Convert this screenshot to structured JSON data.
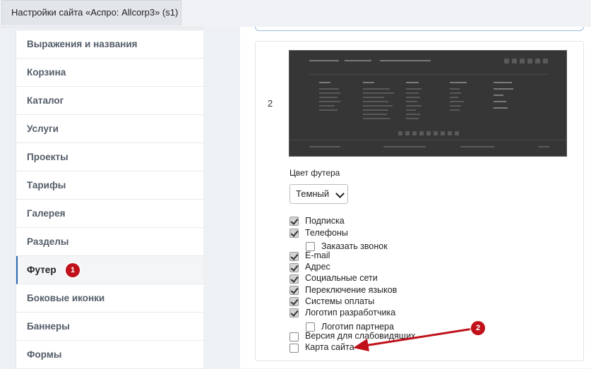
{
  "window": {
    "tab_title": "Настройки сайта «Аспро: Allcorp3» (s1)"
  },
  "sidebar": {
    "items": [
      {
        "label": "Выражения и названия",
        "active": false
      },
      {
        "label": "Корзина",
        "active": false
      },
      {
        "label": "Каталог",
        "active": false
      },
      {
        "label": "Услуги",
        "active": false
      },
      {
        "label": "Проекты",
        "active": false
      },
      {
        "label": "Тарифы",
        "active": false
      },
      {
        "label": "Галерея",
        "active": false
      },
      {
        "label": "Разделы",
        "active": false
      },
      {
        "label": "Футер",
        "active": true
      },
      {
        "label": "Боковые иконки",
        "active": false
      },
      {
        "label": "Баннеры",
        "active": false
      },
      {
        "label": "Формы",
        "active": false
      }
    ]
  },
  "annotations": {
    "badge_1": "1",
    "badge_2": "2"
  },
  "footer_settings": {
    "variant_number": "2",
    "color_label": "Цвет футера",
    "color_value": "Темный",
    "options": [
      {
        "label": "Подписка",
        "checked": true
      },
      {
        "label": "Телефоны",
        "checked": true
      },
      {
        "label": "Заказать звонок",
        "checked": false
      },
      {
        "label": "E-mail",
        "checked": true
      },
      {
        "label": "Адрес",
        "checked": true
      },
      {
        "label": "Социальные сети",
        "checked": true
      },
      {
        "label": "Переключение языков",
        "checked": true
      },
      {
        "label": "Системы оплаты",
        "checked": true
      },
      {
        "label": "Логотип разработчика",
        "checked": true
      },
      {
        "label": "Логотип партнера",
        "checked": false
      },
      {
        "label": "Версия для слабовидящих",
        "checked": false
      },
      {
        "label": "Карта сайта",
        "checked": false
      }
    ]
  },
  "colors": {
    "accent": "#2f69b4",
    "badge": "#c0111a",
    "preview_bg": "#363636"
  }
}
